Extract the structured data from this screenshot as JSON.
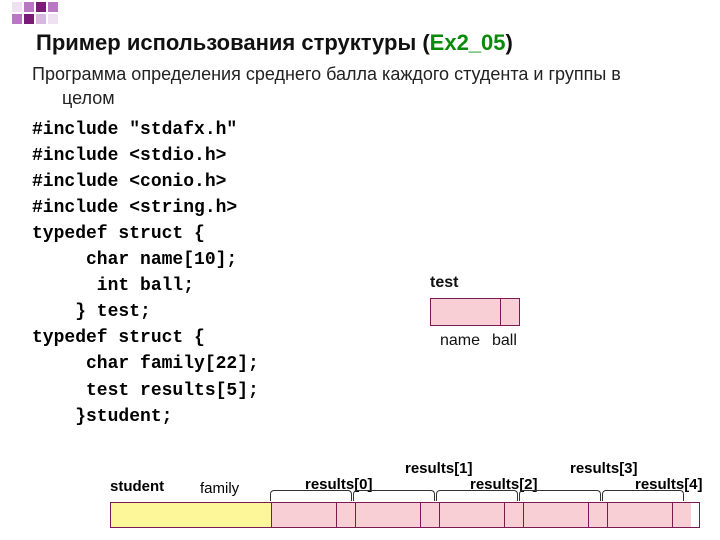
{
  "title_plain": "Пример использования структуры (",
  "title_accent": "Ex2_05",
  "title_close": ")",
  "desc_line1": "Программа определения среднего балла каждого студента и группы в",
  "desc_line2": "целом",
  "code_lines": [
    "#include \"stdafx.h\"",
    "#include <stdio.h>",
    "#include <conio.h>",
    "#include <string.h>",
    "typedef struct {",
    "     char name[10];",
    "      int ball;",
    "    } test;",
    "typedef struct {",
    "     char family[22];",
    "     test results[5];",
    "    }student;"
  ],
  "test": {
    "label": "test",
    "name": "name",
    "ball": "ball"
  },
  "student": {
    "label": "student",
    "family": "family",
    "results": [
      "results[0]",
      "results[1]",
      "results[2]",
      "results[3]",
      "results[4]"
    ]
  }
}
